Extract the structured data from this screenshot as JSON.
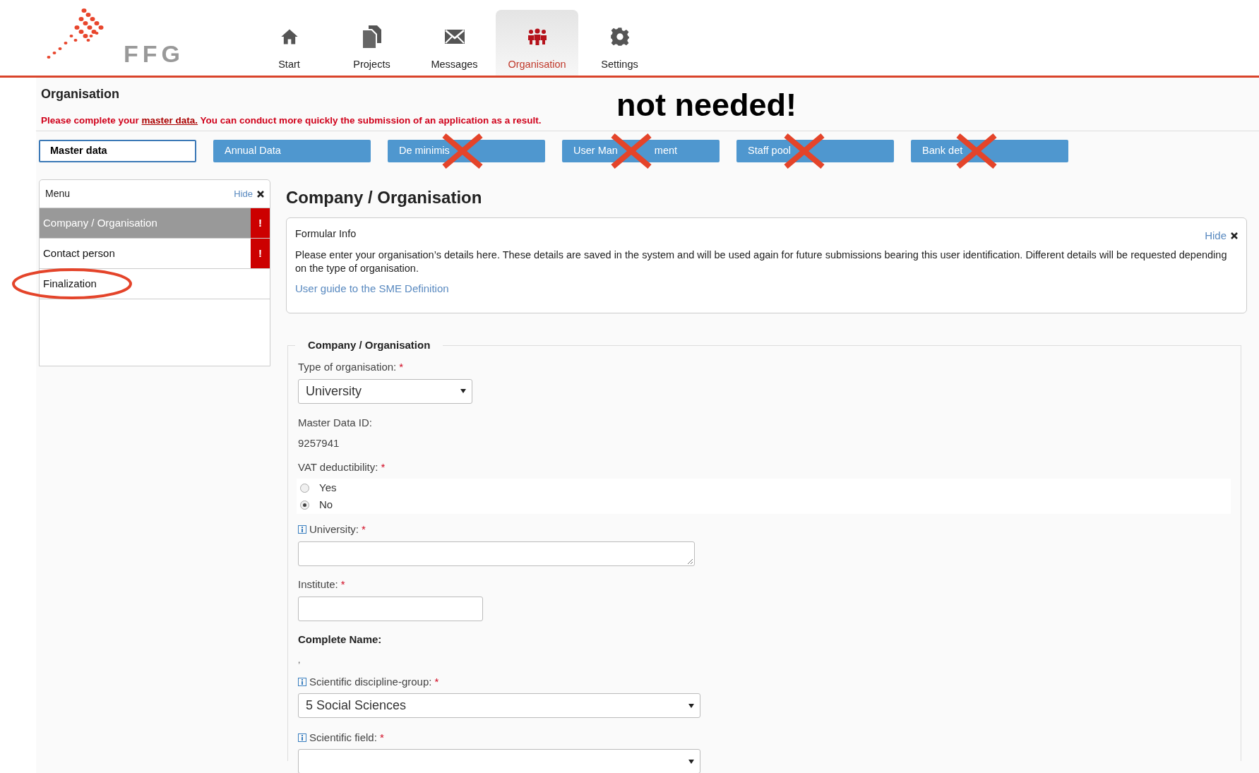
{
  "logo": {
    "text": "FFG"
  },
  "nav": [
    {
      "label": "Start",
      "selected": false
    },
    {
      "label": "Projects",
      "selected": false
    },
    {
      "label": "Messages",
      "selected": false
    },
    {
      "label": "Organisation",
      "selected": true
    },
    {
      "label": "Settings",
      "selected": false
    }
  ],
  "page_title": "Organisation",
  "notice": {
    "before": "Please complete your ",
    "link": "master data.",
    "after": " You can conduct more quickly the submission of an application as a result."
  },
  "annotation": "not needed!",
  "section_buttons": [
    {
      "label": "Master data",
      "selected": true,
      "crossed": false
    },
    {
      "label": "Annual Data",
      "selected": false,
      "crossed": false
    },
    {
      "label": "De minimis",
      "selected": false,
      "crossed": true
    },
    {
      "label": "User Man",
      "label_after": "ment",
      "selected": false,
      "crossed": true
    },
    {
      "label": "Staff pool",
      "selected": false,
      "crossed": true
    },
    {
      "label": "Bank det",
      "selected": false,
      "crossed": true
    }
  ],
  "menu": {
    "title": "Menu",
    "hide": "Hide",
    "items": [
      {
        "label": "Company / Organisation",
        "selected": true,
        "warning": "!"
      },
      {
        "label": "Contact person",
        "selected": false,
        "warning": "!"
      },
      {
        "label": "Finalization",
        "selected": false,
        "circled": true
      }
    ]
  },
  "heading": "Company / Organisation",
  "info": {
    "title": "Formular Info",
    "hide": "Hide",
    "text": "Please enter your organisation’s details here. These details are saved in the system and will be used again for future submissions bearing this user identification. Different details will be requested depending on the type of organisation.",
    "link": "User guide to the SME Definition"
  },
  "fieldset": {
    "legend": "Company / Organisation",
    "fields": [
      {
        "kind": "select",
        "label": "Type of organisation:",
        "required": "*",
        "value": "University"
      },
      {
        "kind": "static",
        "label": "Master Data ID:",
        "value": "9257941"
      },
      {
        "kind": "radio",
        "label": "VAT deductibility:",
        "required": "*",
        "options": [
          {
            "label": "Yes",
            "selected": false
          },
          {
            "label": "No",
            "selected": true
          }
        ]
      },
      {
        "kind": "textarea",
        "label": "University:",
        "required": "*",
        "info": true
      },
      {
        "kind": "text",
        "label": "Institute:",
        "required": "*"
      },
      {
        "kind": "heading",
        "label": "Complete Name:",
        "value": ","
      },
      {
        "kind": "select",
        "label": "Scientific discipline-group:",
        "required": "*",
        "value": "5 Social Sciences",
        "info": true
      },
      {
        "kind": "select",
        "label": "Scientific field:",
        "required": "*",
        "info": true
      }
    ]
  }
}
